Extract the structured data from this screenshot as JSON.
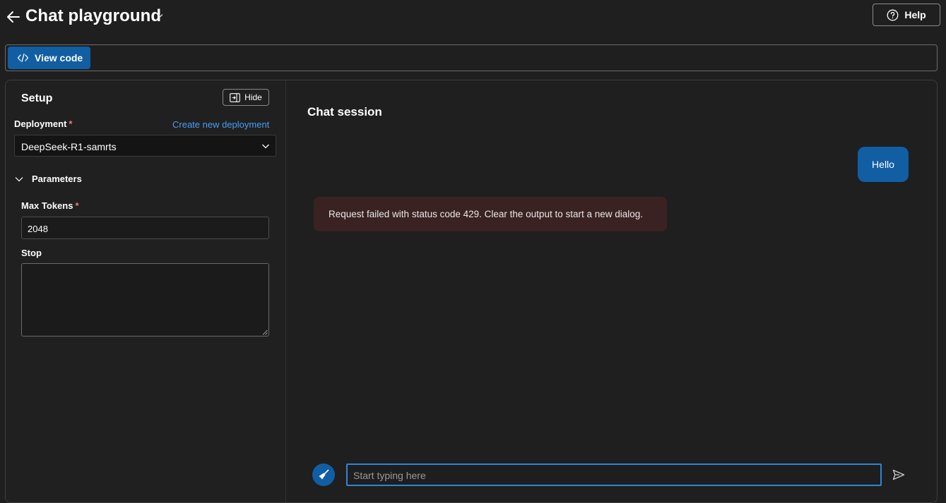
{
  "header": {
    "title": "Chat playground",
    "help_label": "Help"
  },
  "toolbar": {
    "view_code_label": "View code"
  },
  "setup": {
    "title": "Setup",
    "hide_label": "Hide",
    "deployment_label": "Deployment",
    "required_marker": "*",
    "create_link": "Create new deployment",
    "deployment_value": "DeepSeek-R1-samrts",
    "parameters_label": "Parameters",
    "max_tokens_label": "Max Tokens",
    "max_tokens_value": "2048",
    "stop_label": "Stop",
    "stop_value": ""
  },
  "chat": {
    "title": "Chat session",
    "messages": [
      {
        "role": "user",
        "text": "Hello"
      },
      {
        "role": "error",
        "text": "Request failed with status code 429. Clear the output to start a new dialog."
      }
    ],
    "input_placeholder": "Start typing here"
  },
  "colors": {
    "background": "#1f1f1f",
    "accent": "#115ea3",
    "link": "#479ef5",
    "error_bg": "#3b2222",
    "required": "#e37d80"
  }
}
